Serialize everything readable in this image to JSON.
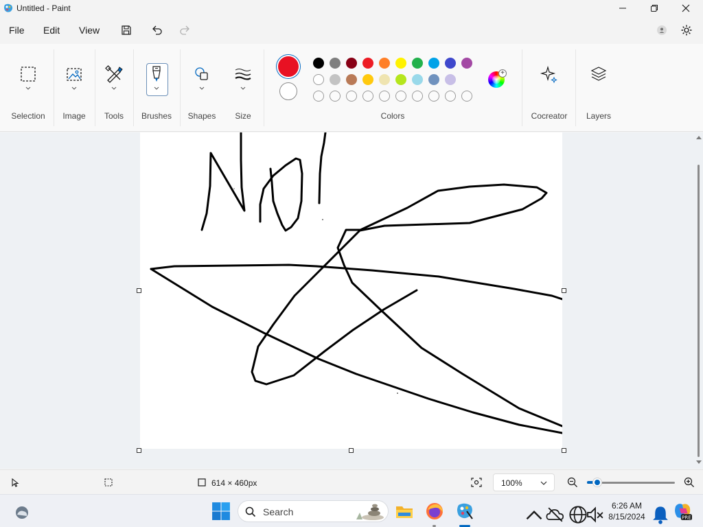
{
  "window": {
    "title": "Untitled - Paint"
  },
  "menu": {
    "file": "File",
    "edit": "Edit",
    "view": "View"
  },
  "ribbon": {
    "groups": {
      "selection": "Selection",
      "image": "Image",
      "tools": "Tools",
      "brushes": "Brushes",
      "shapes": "Shapes",
      "size": "Size",
      "colors": "Colors",
      "cocreator": "Cocreator",
      "layers": "Layers"
    },
    "primary_color": "#e81123",
    "secondary_color": "#ffffff",
    "palette_row1": [
      "#000000",
      "#7f7f7f",
      "#880015",
      "#ed1c24",
      "#ff7f27",
      "#fff200",
      "#22b14c",
      "#00a2e8",
      "#3f48cc",
      "#a349a4"
    ],
    "palette_row2": [
      "#ffffff",
      "#c3c3c3",
      "#b97a57",
      "#ffc90e",
      "#efe4b0",
      "#b5e61d",
      "#99d9ea",
      "#7092be",
      "#c8bfe7"
    ]
  },
  "status": {
    "canvas_size": "614 × 460px",
    "zoom": "100%",
    "zoom_fraction": 0.12
  },
  "taskbar": {
    "search_placeholder": "Search",
    "time": "6:26 AM",
    "date": "8/15/2024"
  }
}
